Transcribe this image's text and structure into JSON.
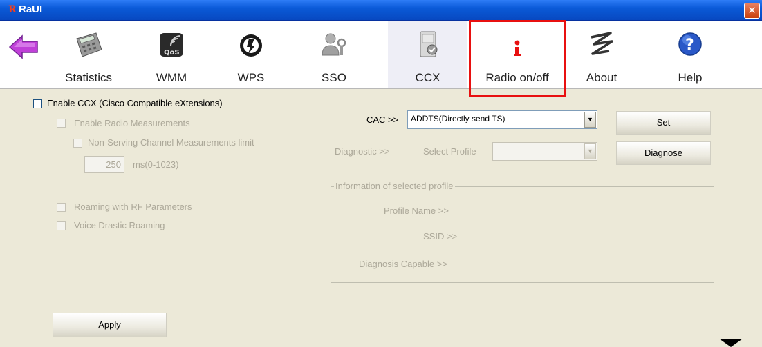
{
  "window": {
    "title": "RaUI",
    "logo_glyph": "R",
    "close_glyph": "✕"
  },
  "toolbar": {
    "back_icon": "back-arrow-icon",
    "items": [
      {
        "label": "Statistics",
        "icon": "calculator-icon"
      },
      {
        "label": "WMM",
        "icon": "qos-icon"
      },
      {
        "label": "WPS",
        "icon": "wps-icon"
      },
      {
        "label": "SSO",
        "icon": "sso-icon"
      },
      {
        "label": "CCX",
        "icon": "ccx-icon"
      },
      {
        "label": "Radio on/off",
        "icon": "radio-icon"
      },
      {
        "label": "About",
        "icon": "about-icon"
      },
      {
        "label": "Help",
        "icon": "help-icon"
      }
    ],
    "active": "CCX",
    "highlighted": "Radio on/off"
  },
  "ccx": {
    "enable_label": "Enable CCX (Cisco Compatible eXtensions)",
    "radio_measurements_label": "Enable Radio Measurements",
    "non_serving_label": "Non-Serving Channel Measurements limit",
    "limit_value": "250",
    "limit_unit": "ms(0-1023)",
    "roaming_rf_label": "Roaming with RF Parameters",
    "voice_roaming_label": "Voice Drastic Roaming",
    "apply_label": "Apply"
  },
  "cac": {
    "label": "CAC >>",
    "selected": "ADDTS(Directly send TS)",
    "set_label": "Set"
  },
  "diagnostic": {
    "label": "Diagnostic >>",
    "select_profile_label": "Select Profile",
    "selected": "",
    "diagnose_label": "Diagnose"
  },
  "profile_info": {
    "group_title": "Information of selected profile",
    "profile_name_label": "Profile Name >>",
    "ssid_label": "SSID >>",
    "diagnosis_capable_label": "Diagnosis Capable >>"
  },
  "colors": {
    "highlight": "#E81010",
    "titlebar": "#0A5AD8",
    "dialog_bg": "#ECE9D8",
    "disabled_text": "#ACA899"
  }
}
